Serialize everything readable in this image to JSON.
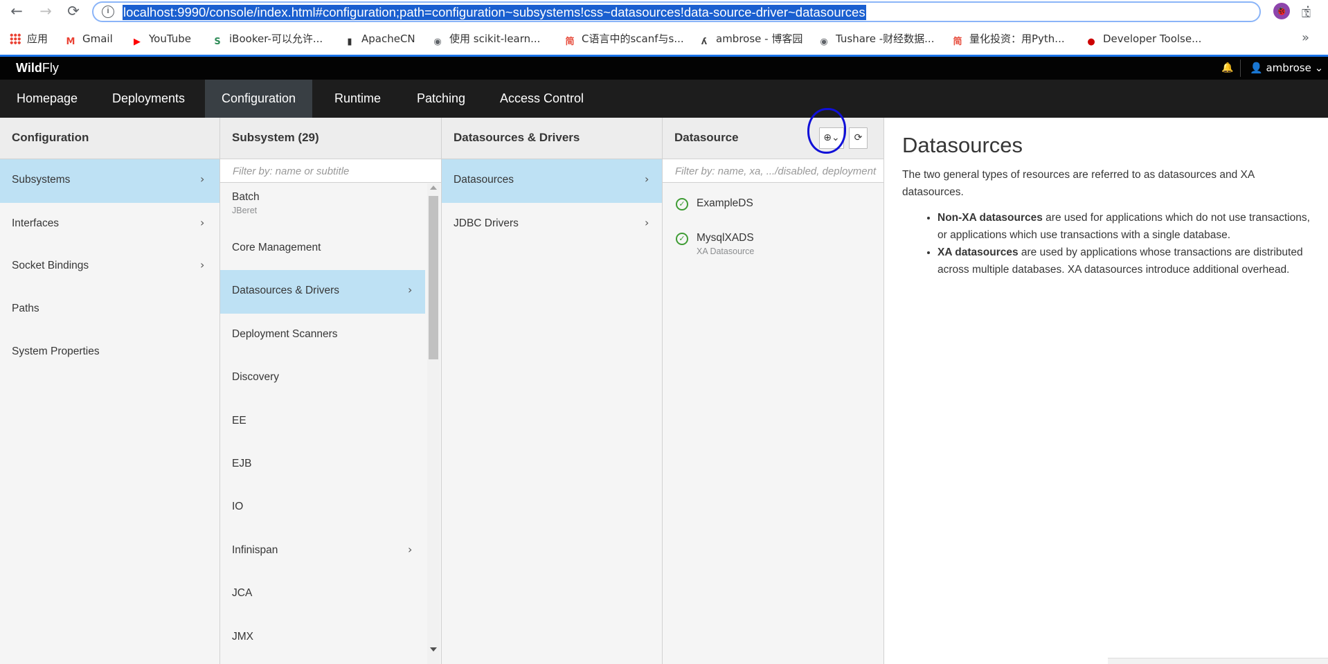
{
  "browser": {
    "url": "localhost:9990/console/index.html#configuration;path=configuration~subsystems!css~datasources!data-source-driver~datasources",
    "back_glyph": "←",
    "forward_glyph": "→",
    "reload_glyph": "⟳",
    "profile_glyph": "🐞",
    "bookmarks": [
      {
        "label": "应用",
        "icon": "apps-grid-icon"
      },
      {
        "label": "Gmail",
        "icon": "gmail-icon",
        "color": "#ea4335",
        "glyph": "M"
      },
      {
        "label": "YouTube",
        "icon": "youtube-icon",
        "color": "#ff0000",
        "glyph": "▶"
      },
      {
        "label": "iBooker-可以允许...",
        "icon": "ibooker-icon",
        "color": "#2e8b57",
        "glyph": "S"
      },
      {
        "label": "ApacheCN",
        "icon": "book-icon",
        "color": "#333333",
        "glyph": "▮"
      },
      {
        "label": "使用 scikit-learn...",
        "icon": "globe-icon",
        "color": "#5f6368",
        "glyph": "◉"
      },
      {
        "label": "C语言中的scanf与s...",
        "icon": "jian-icon",
        "color": "#e74c3c",
        "glyph": "简"
      },
      {
        "label": "ambrose - 博客园",
        "icon": "cnblogs-icon",
        "color": "#444444",
        "glyph": "ʎ"
      },
      {
        "label": "Tushare -财经数据...",
        "icon": "globe-icon",
        "color": "#5f6368",
        "glyph": "◉"
      },
      {
        "label": "量化投资：用Pyth...",
        "icon": "jian-icon",
        "color": "#e74c3c",
        "glyph": "简"
      },
      {
        "label": "Developer Toolse...",
        "icon": "redhat-icon",
        "color": "#cc0000",
        "glyph": "●"
      }
    ],
    "more_glyph": "»"
  },
  "header": {
    "logo_bold": "Wild",
    "logo_rest": "Fly",
    "user": "ambrose",
    "user_glyph": "👤",
    "bell_glyph": "🔔"
  },
  "nav": {
    "tabs": [
      {
        "label": "Homepage"
      },
      {
        "label": "Deployments"
      },
      {
        "label": "Configuration",
        "active": true
      },
      {
        "label": "Runtime"
      },
      {
        "label": "Patching"
      },
      {
        "label": "Access Control"
      }
    ]
  },
  "col1": {
    "title": "Configuration",
    "items": [
      {
        "label": "Subsystems",
        "selected": true,
        "chevron": true
      },
      {
        "label": "Interfaces",
        "chevron": true
      },
      {
        "label": "Socket Bindings",
        "chevron": true
      },
      {
        "label": "Paths"
      },
      {
        "label": "System Properties"
      }
    ]
  },
  "col2": {
    "title": "Subsystem (29)",
    "filter_placeholder": "Filter by: name or subtitle",
    "items": [
      {
        "label": "Batch",
        "subtitle": "JBeret"
      },
      {
        "label": "Core Management"
      },
      {
        "label": "Datasources & Drivers",
        "selected": true,
        "chevron": true
      },
      {
        "label": "Deployment Scanners"
      },
      {
        "label": "Discovery"
      },
      {
        "label": "EE"
      },
      {
        "label": "EJB"
      },
      {
        "label": "IO"
      },
      {
        "label": "Infinispan",
        "chevron": true
      },
      {
        "label": "JCA"
      },
      {
        "label": "JMX"
      }
    ]
  },
  "col3": {
    "title": "Datasources & Drivers",
    "items": [
      {
        "label": "Datasources",
        "selected": true,
        "chevron": true
      },
      {
        "label": "JDBC Drivers",
        "chevron": true
      }
    ]
  },
  "col4": {
    "title": "Datasource",
    "filter_placeholder": "Filter by: name, xa, .../disabled, deployment",
    "add_button": "⊕⌄",
    "refresh_button": "⟳",
    "items": [
      {
        "label": "ExampleDS",
        "status": "ok"
      },
      {
        "label": "MysqlXADS",
        "subtitle": "XA Datasource",
        "status": "ok"
      }
    ]
  },
  "preview": {
    "title": "Datasources",
    "description": "The two general types of resources are referred to as datasources and XA datasources.",
    "bullets": [
      {
        "bold": "Non-XA datasources",
        "text": " are used for applications which do not use transactions, or applications which use transactions with a single database."
      },
      {
        "bold": "XA datasources",
        "text": " are used by applications whose transactions are distributed across multiple databases. XA datasources introduce additional overhead."
      }
    ]
  },
  "glyphs": {
    "chevron": "›",
    "check": "✓",
    "star": "☆",
    "key": "⚿",
    "menu": "⋮"
  }
}
